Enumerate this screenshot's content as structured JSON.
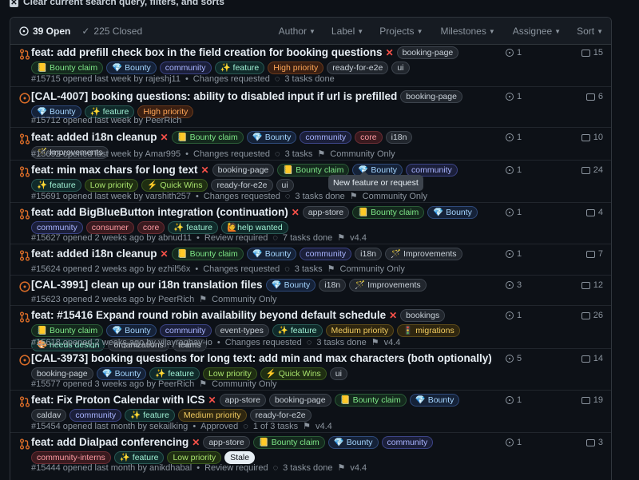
{
  "clear_bar": {
    "icon": "close-icon",
    "text": "Clear current search query, filters, and sorts"
  },
  "header": {
    "open_count": "39 Open",
    "closed_count": "225 Closed",
    "filters": [
      "Author",
      "Label",
      "Projects",
      "Milestones",
      "Assignee",
      "Sort"
    ]
  },
  "tooltip": "New feature or request",
  "colors": {
    "open_green": "#3fb950",
    "pr_orange": "#db6d28",
    "muted": "#8b949e",
    "closed_red": "#f85149"
  },
  "rows": [
    {
      "type": "pr",
      "title": "feat: add prefill check box in the field creation for booking questions",
      "failed": true,
      "labels": [
        [
          "booking-page",
          "gray"
        ],
        [
          "📒 Bounty claim",
          "green"
        ],
        [
          "💎 Bounty",
          "blue"
        ],
        [
          "community",
          "blue2"
        ],
        [
          "✨ feature",
          "teal"
        ],
        [
          "High priority",
          "orange"
        ],
        [
          "ready-for-e2e",
          "gray"
        ],
        [
          "ui",
          "gray"
        ]
      ],
      "meta": [
        "#15715 opened last week by rajeshj11",
        "Changes requested",
        "3 tasks done"
      ],
      "ci": "1",
      "comments": "15"
    },
    {
      "type": "issue",
      "title": "[CAL-4007] booking questions: ability to disabled input if url is prefilled",
      "failed": false,
      "labels": [
        [
          "booking-page",
          "gray"
        ],
        [
          "💎 Bounty",
          "blue"
        ],
        [
          "✨ feature",
          "teal"
        ],
        [
          "High priority",
          "orange"
        ]
      ],
      "meta": [
        "#15712 opened last week by PeerRich"
      ],
      "ci": "1",
      "comments": "6"
    },
    {
      "type": "pr",
      "title": "feat: added i18n cleanup",
      "failed": true,
      "labels": [
        [
          "📒 Bounty claim",
          "green"
        ],
        [
          "💎 Bounty",
          "blue"
        ],
        [
          "community",
          "blue2"
        ],
        [
          "core",
          "red"
        ],
        [
          "i18n",
          "gray"
        ],
        [
          "🪄 Improvements",
          "gray"
        ]
      ],
      "meta": [
        "#15692 opened last week by Amar995",
        "Changes requested",
        "3 tasks",
        "Community Only"
      ],
      "ci": "1",
      "comments": "10"
    },
    {
      "type": "pr",
      "title": "feat: min max chars for long text",
      "failed": true,
      "labels": [
        [
          "booking-page",
          "gray"
        ],
        [
          "📒 Bounty claim",
          "green"
        ],
        [
          "💎 Bounty",
          "blue"
        ],
        [
          "community",
          "blue2"
        ],
        [
          "✨ feature",
          "teal"
        ],
        [
          "Low priority",
          "lime"
        ],
        [
          "⚡ Quick Wins",
          "lime"
        ],
        [
          "ready-for-e2e",
          "gray"
        ],
        [
          "ui",
          "gray"
        ]
      ],
      "meta": [
        "#15691 opened last week by varshith257",
        "Changes requested",
        "3 tasks done",
        "Community Only"
      ],
      "ci": "1",
      "comments": "24"
    },
    {
      "type": "pr",
      "title": "feat: add BigBlueButton integration (continuation)",
      "failed": true,
      "labels": [
        [
          "app-store",
          "gray"
        ],
        [
          "📒 Bounty claim",
          "green"
        ],
        [
          "💎 Bounty",
          "blue"
        ],
        [
          "community",
          "blue2"
        ],
        [
          "consumer",
          "red"
        ],
        [
          "core",
          "red"
        ],
        [
          "✨ feature",
          "teal"
        ],
        [
          "🙋help wanted",
          "teal"
        ]
      ],
      "meta": [
        "#15627 opened 2 weeks ago by abnud11",
        "Review required",
        "7 tasks done",
        "v4.4"
      ],
      "ci": "1",
      "comments": "4"
    },
    {
      "type": "pr",
      "title": "feat: added i18n cleanup",
      "failed": true,
      "labels": [
        [
          "📒 Bounty claim",
          "green"
        ],
        [
          "💎 Bounty",
          "blue"
        ],
        [
          "community",
          "blue2"
        ],
        [
          "i18n",
          "gray"
        ],
        [
          "🪄 Improvements",
          "gray"
        ]
      ],
      "meta": [
        "#15624 opened 2 weeks ago by ezhil56x",
        "Changes requested",
        "3 tasks",
        "Community Only"
      ],
      "ci": "1",
      "comments": "7"
    },
    {
      "type": "issue",
      "title": "[CAL-3991] clean up our i18n translation files",
      "failed": false,
      "labels": [
        [
          "💎 Bounty",
          "blue"
        ],
        [
          "i18n",
          "gray"
        ],
        [
          "🪄 Improvements",
          "gray"
        ]
      ],
      "meta": [
        "#15623 opened 2 weeks ago by PeerRich",
        "Community Only"
      ],
      "ci": "3",
      "comments": "12"
    },
    {
      "type": "pr",
      "title": "feat: #15416 Expand round robin availability beyond default schedule",
      "failed": true,
      "labels": [
        [
          "bookings",
          "gray"
        ],
        [
          "📒 Bounty claim",
          "green"
        ],
        [
          "💎 Bounty",
          "blue"
        ],
        [
          "community",
          "blue2"
        ],
        [
          "event-types",
          "gray"
        ],
        [
          "✨ feature",
          "teal"
        ],
        [
          "Medium priority",
          "yellow"
        ],
        [
          "🚦 migrations",
          "yellow"
        ],
        [
          "🎨 needs design",
          "teal"
        ],
        [
          "organizations",
          "gray"
        ],
        [
          "teams",
          "gray"
        ]
      ],
      "meta": [
        "#15618 opened 2 weeks ago by vijayraghav-io",
        "Changes requested",
        "3 tasks done",
        "v4.4"
      ],
      "ci": "1",
      "comments": "26"
    },
    {
      "type": "issue",
      "title": "[CAL-3973] booking questions for long text: add min and max characters (both optionally)",
      "failed": false,
      "labels": [
        [
          "booking-page",
          "gray"
        ],
        [
          "💎 Bounty",
          "blue"
        ],
        [
          "✨ feature",
          "teal"
        ],
        [
          "Low priority",
          "lime"
        ],
        [
          "⚡ Quick Wins",
          "lime"
        ],
        [
          "ui",
          "gray"
        ]
      ],
      "meta": [
        "#15577 opened 3 weeks ago by PeerRich",
        "Community Only"
      ],
      "ci": "5",
      "comments": "14"
    },
    {
      "type": "pr",
      "title": "feat: Fix Proton Calendar with ICS",
      "failed": true,
      "labels": [
        [
          "app-store",
          "gray"
        ],
        [
          "booking-page",
          "gray"
        ],
        [
          "📒 Bounty claim",
          "green"
        ],
        [
          "💎 Bounty",
          "blue"
        ],
        [
          "caldav",
          "gray"
        ],
        [
          "community",
          "blue2"
        ],
        [
          "✨ feature",
          "teal"
        ],
        [
          "Medium priority",
          "yellow"
        ],
        [
          "ready-for-e2e",
          "gray"
        ]
      ],
      "meta": [
        "#15454 opened last month by sekailking",
        "Approved",
        "1 of 3 tasks",
        "v4.4"
      ],
      "ci": "1",
      "comments": "19"
    },
    {
      "type": "pr",
      "title": "feat: add Dialpad conferencing",
      "failed": true,
      "labels": [
        [
          "app-store",
          "gray"
        ],
        [
          "📒 Bounty claim",
          "green"
        ],
        [
          "💎 Bounty",
          "blue"
        ],
        [
          "community",
          "blue2"
        ],
        [
          "community-interns",
          "red"
        ],
        [
          "✨ feature",
          "teal"
        ],
        [
          "Low priority",
          "lime"
        ],
        [
          "Stale",
          "white"
        ]
      ],
      "meta": [
        "#15444 opened last month by anikdhabal",
        "Review required",
        "3 tasks done",
        "v4.4"
      ],
      "ci": "1",
      "comments": "3"
    }
  ]
}
